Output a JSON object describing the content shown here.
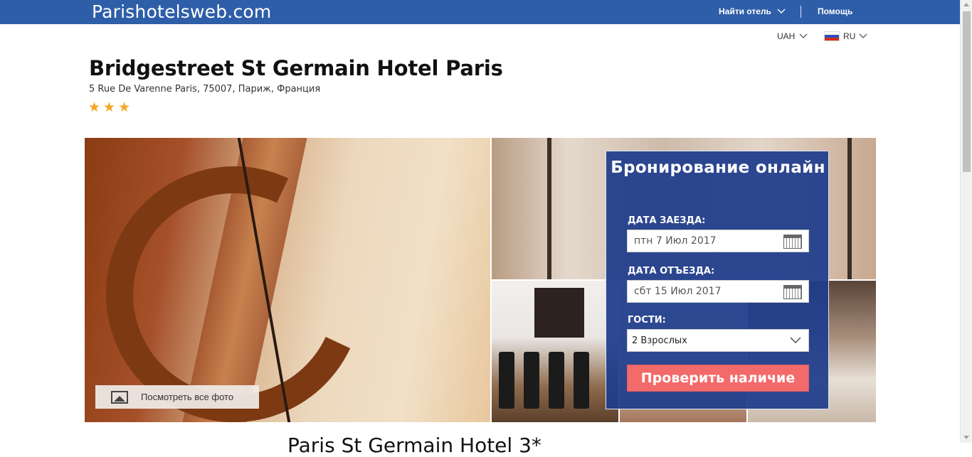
{
  "header": {
    "brand": "Parishotelsweb.com",
    "find_hotel_label": "Найти отель",
    "help_label": "Помощь",
    "currency": "UAH",
    "language": "RU"
  },
  "hotel": {
    "name": "Bridgestreet St Germain Hotel Paris",
    "address": "5 Rue De Varenne Paris, 75007, Париж, Франция",
    "stars": 3
  },
  "gallery": {
    "view_all_label": "Посмотреть все фото"
  },
  "booking": {
    "title": "Бронирование онлайн",
    "checkin_label": "ДАТА ЗАЕЗДА:",
    "checkin_value": "птн 7 Июл 2017",
    "checkout_label": "ДАТА ОТЪЕЗДА:",
    "checkout_value": "сбт 15 Июл 2017",
    "guests_label": "ГОСТИ:",
    "guests_value": "2 Взрослых",
    "submit_label": "Проверить наличие"
  },
  "content": {
    "subheading": "Paris St Germain Hotel 3*"
  },
  "colors": {
    "topbar": "#2f5ea8",
    "booking_panel": "#1e3c8c",
    "cta": "#f36a6a",
    "star": "#f5a623"
  }
}
